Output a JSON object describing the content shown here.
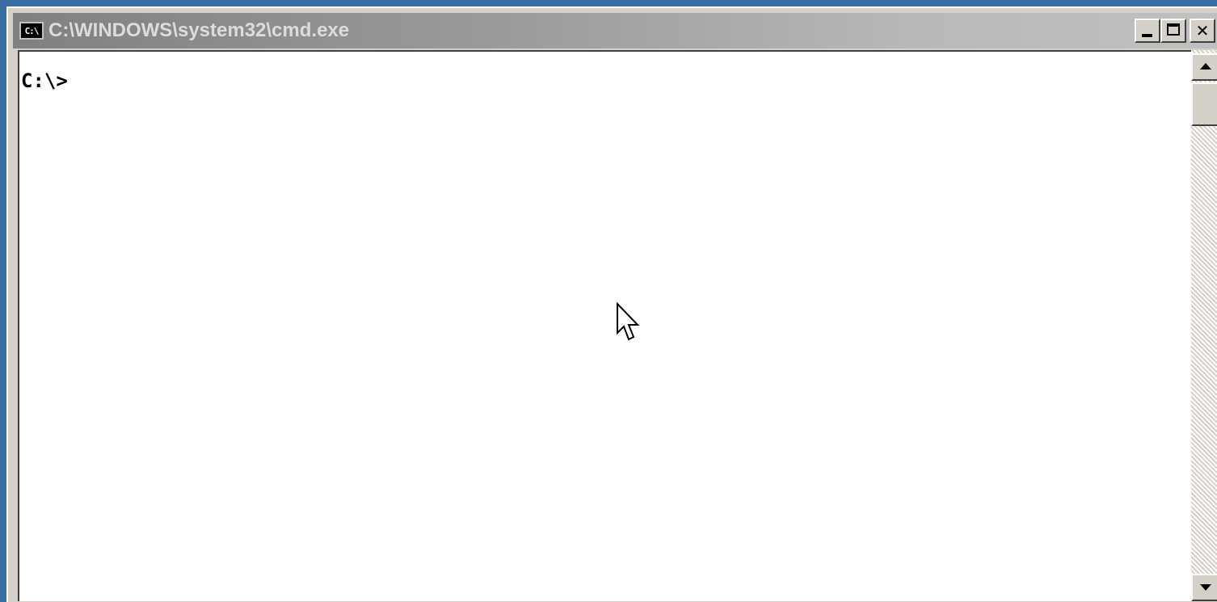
{
  "window": {
    "title": "C:\\WINDOWS\\system32\\cmd.exe",
    "icon_label": "C:\\",
    "controls": {
      "minimize": "minimize-icon",
      "maximize": "maximize-icon",
      "close": "close-icon",
      "close_glyph": "✕"
    }
  },
  "console": {
    "prompt": "C:\\>"
  },
  "colors": {
    "desktop": "#3a6ea5",
    "chrome": "#d4d0c8",
    "console_bg": "#ffffff",
    "console_text": "#000000"
  }
}
